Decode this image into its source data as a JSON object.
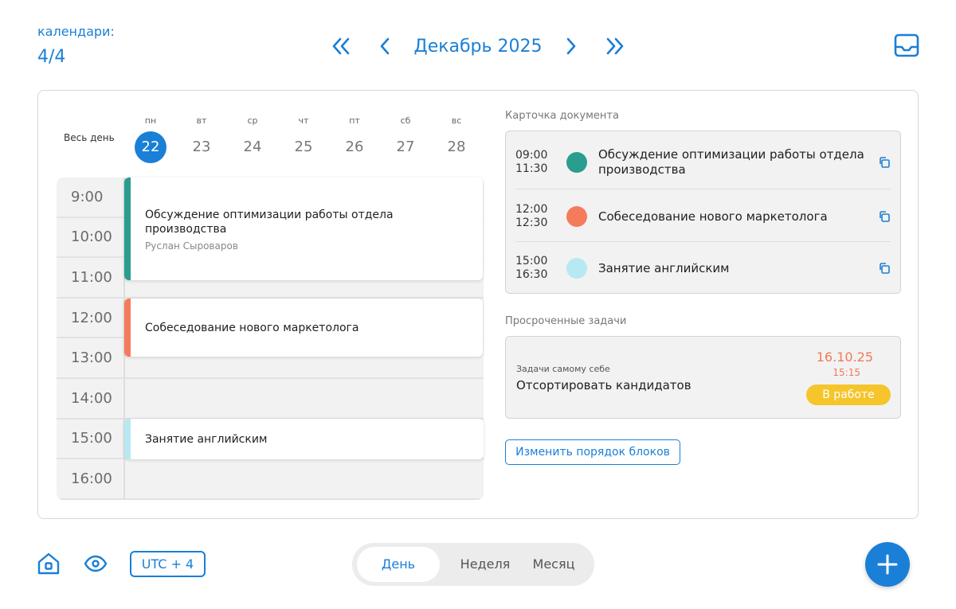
{
  "header": {
    "calendars_label": "календари:",
    "calendars_value": "4/4",
    "month_title": "Декабрь 2025",
    "icons": [
      "double-chevron-left-icon",
      "chevron-left-icon",
      "chevron-right-icon",
      "double-chevron-right-icon",
      "inbox-icon"
    ]
  },
  "week": {
    "all_day_label": "Весь день",
    "days": [
      {
        "dow": "пн",
        "num": "22",
        "active": true
      },
      {
        "dow": "вт",
        "num": "23"
      },
      {
        "dow": "ср",
        "num": "24"
      },
      {
        "dow": "чт",
        "num": "25"
      },
      {
        "dow": "пт",
        "num": "26"
      },
      {
        "dow": "сб",
        "num": "27"
      },
      {
        "dow": "вс",
        "num": "28"
      }
    ]
  },
  "timeline": {
    "hours": [
      "9:00",
      "10:00",
      "11:00",
      "12:00",
      "13:00",
      "14:00",
      "15:00",
      "16:00"
    ],
    "events": [
      {
        "title": "Обсуждение оптимизации работы отдела производства",
        "person": "Руслан Сыроваров",
        "color": "#2a9d8f"
      },
      {
        "title": "Собеседование нового маркетолога",
        "color": "#f47c5c"
      },
      {
        "title": "Занятие английским",
        "color": "#b7e9f2"
      }
    ]
  },
  "doc_card": {
    "label": "Карточка документа",
    "items": [
      {
        "start": "09:00",
        "end": "11:30",
        "title": "Обсуждение оптимизации работы отдела производства",
        "color": "#2a9d8f"
      },
      {
        "start": "12:00",
        "end": "12:30",
        "title": "Собеседование нового маркетолога",
        "color": "#f47c5c"
      },
      {
        "start": "15:00",
        "end": "16:30",
        "title": "Занятие английским",
        "color": "#b7e9f2"
      }
    ]
  },
  "overdue": {
    "label": "Просроченные задачи",
    "task": {
      "category": "Задачи самому себе",
      "title": "Отсортировать кандидатов",
      "date": "16.10.25",
      "time": "15:15",
      "status": "В работе",
      "status_color": "#f5c52b"
    }
  },
  "reorder_button": "Изменить порядок блоков",
  "footer": {
    "timezone": "UTC + 4",
    "views": [
      "День",
      "Неделя",
      "Месяц"
    ],
    "active_view": "День"
  },
  "colors": {
    "accent": "#1a7fd6"
  }
}
